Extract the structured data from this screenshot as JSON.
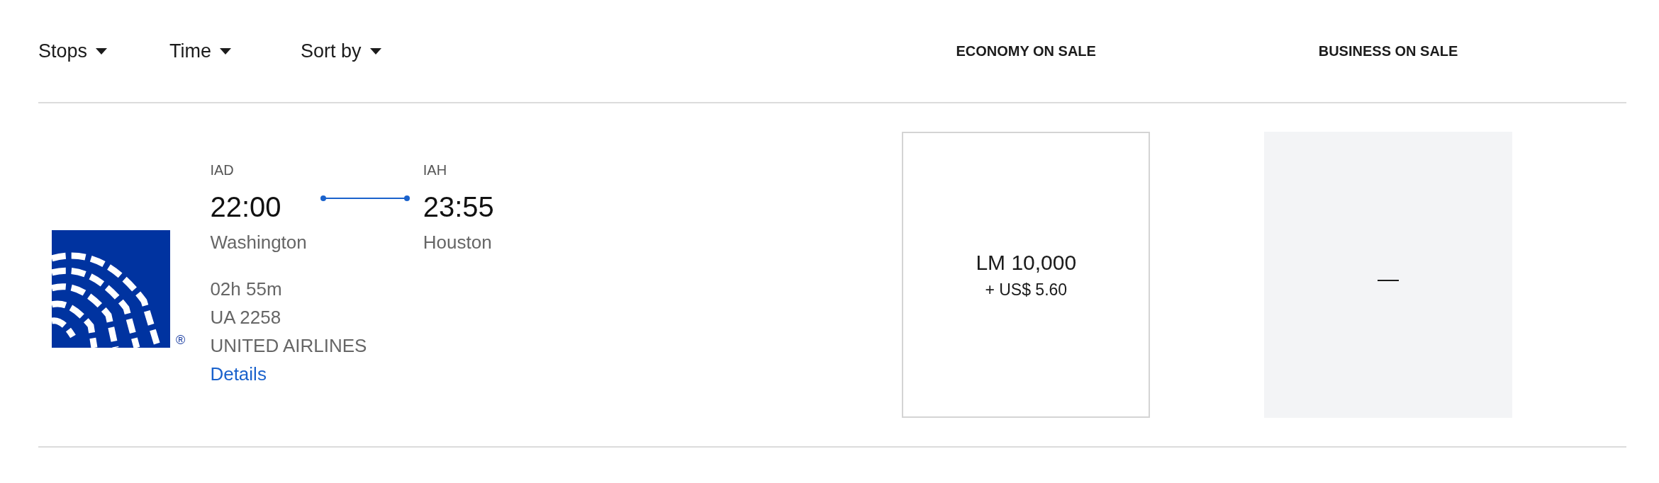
{
  "filters": [
    {
      "label": "Stops"
    },
    {
      "label": "Time"
    },
    {
      "label": "Sort by"
    }
  ],
  "columns": [
    "ECONOMY ON SALE",
    "BUSINESS ON SALE"
  ],
  "flights": [
    {
      "origin": {
        "code": "IAD",
        "time": "22:00",
        "city": "Washington"
      },
      "destination": {
        "code": "IAH",
        "time": "23:55",
        "city": "Houston"
      },
      "duration": "02h 55m",
      "flight_number": "UA 2258",
      "airline": "UNITED AIRLINES",
      "details_link": "Details",
      "registered_mark": "®",
      "fares": [
        {
          "available": true,
          "miles": "LM 10,000",
          "tax": "+ US$ 5.60"
        },
        {
          "available": false,
          "placeholder": "—"
        }
      ]
    }
  ]
}
